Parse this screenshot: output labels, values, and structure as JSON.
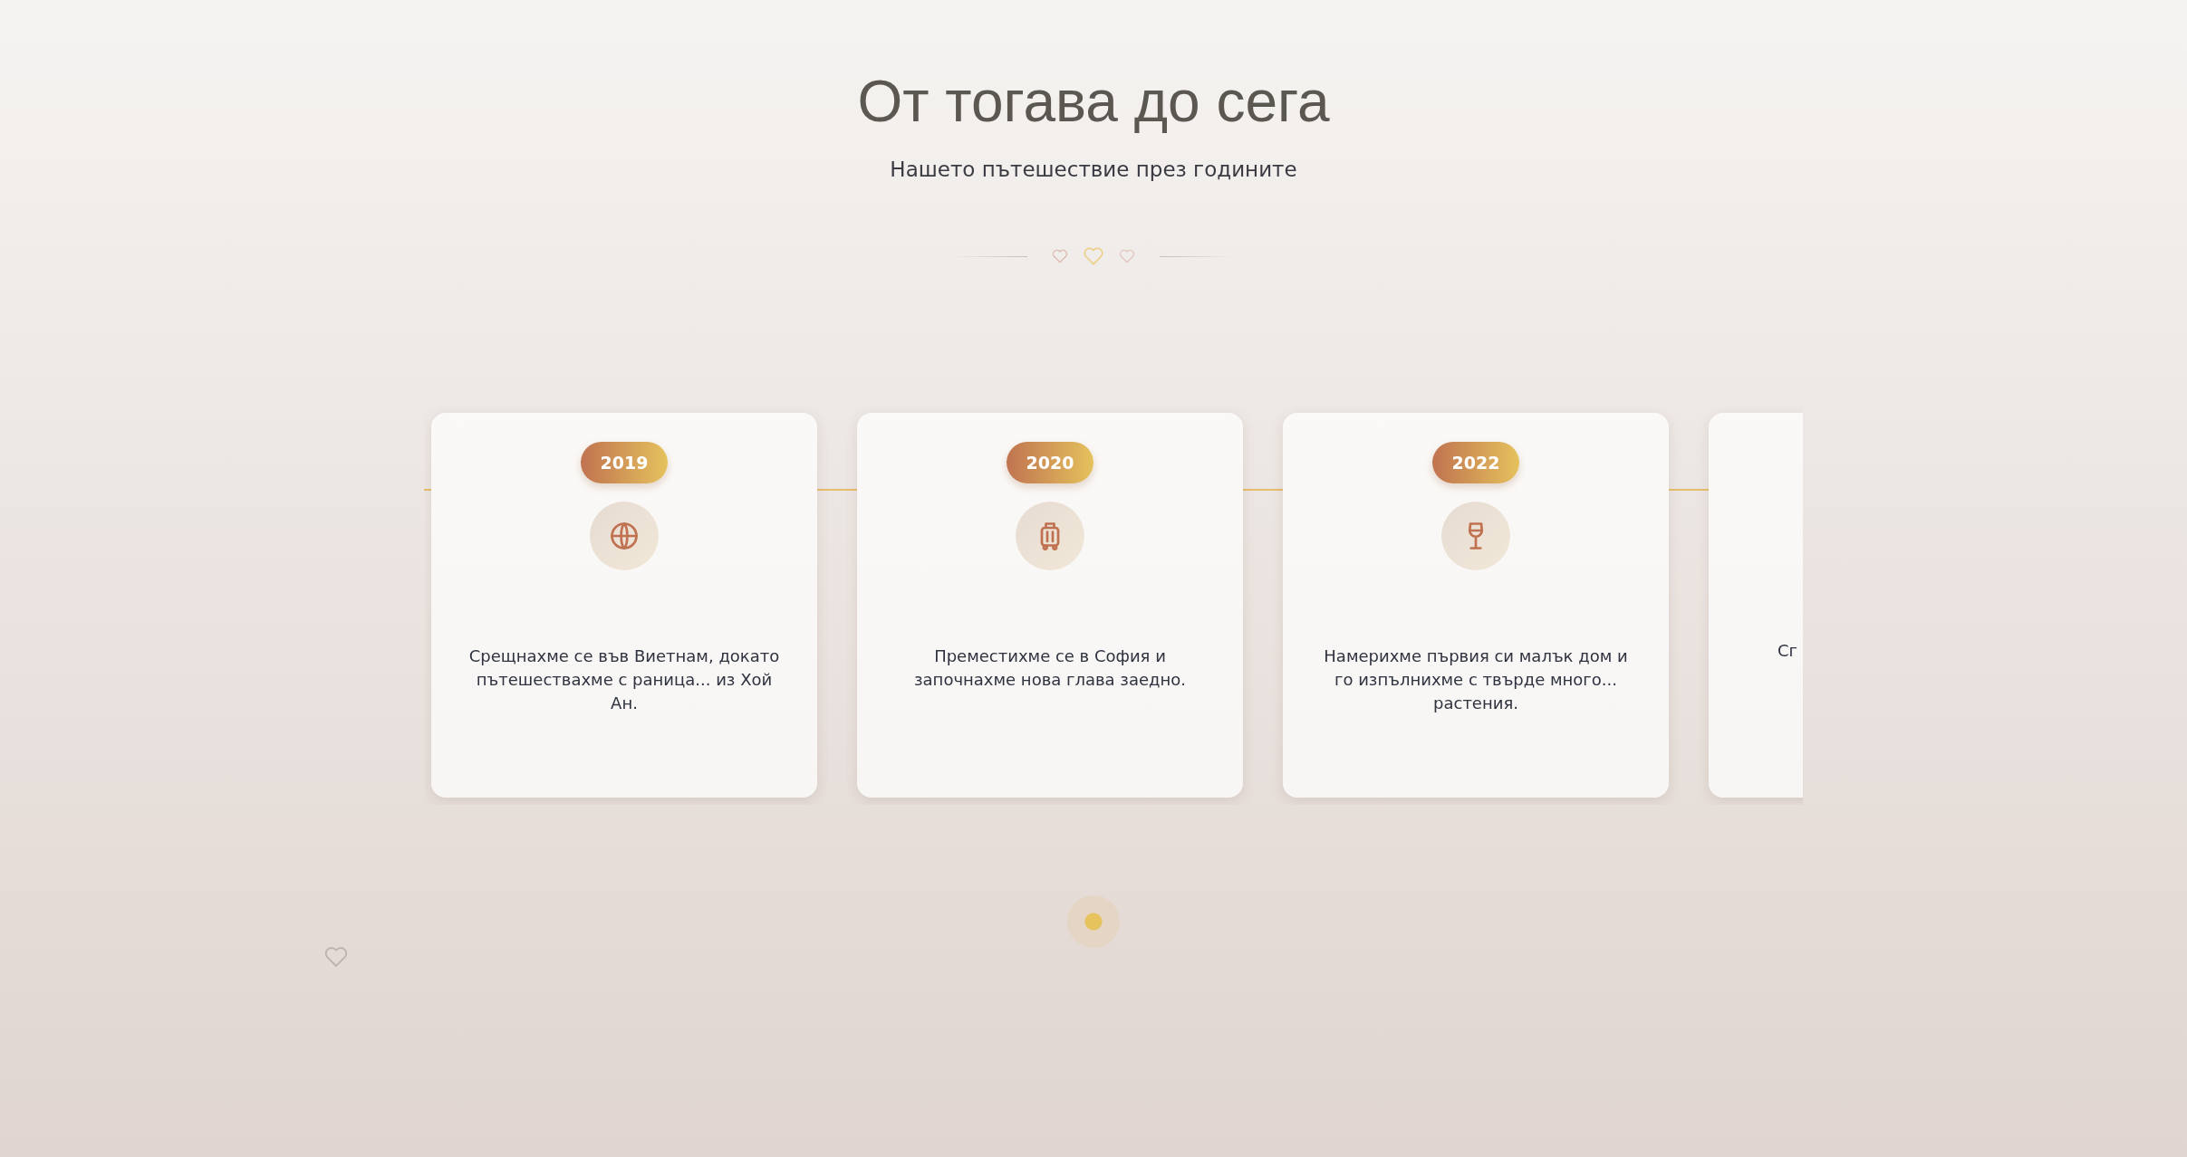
{
  "header": {
    "title": "От тогава до сега",
    "subtitle": "Нашето пътешествие през годините"
  },
  "timeline": {
    "events": [
      {
        "year": "2019",
        "kind": "globe",
        "text": "Срещнахме се във Виетнам, докато пътешествахме с раница... из Хой Ан."
      },
      {
        "year": "2020",
        "kind": "suitcase",
        "text": "Преместихме се в София и започнахме нова глава заедно."
      },
      {
        "year": "2022",
        "kind": "glass",
        "text": "Намерихме първия си малък дом и го изпълнихме с твърде много... растения."
      },
      {
        "kind": "clipped",
        "text": "Сг"
      }
    ]
  },
  "pagination": {
    "dots": [
      {
        "selected": true
      }
    ]
  }
}
